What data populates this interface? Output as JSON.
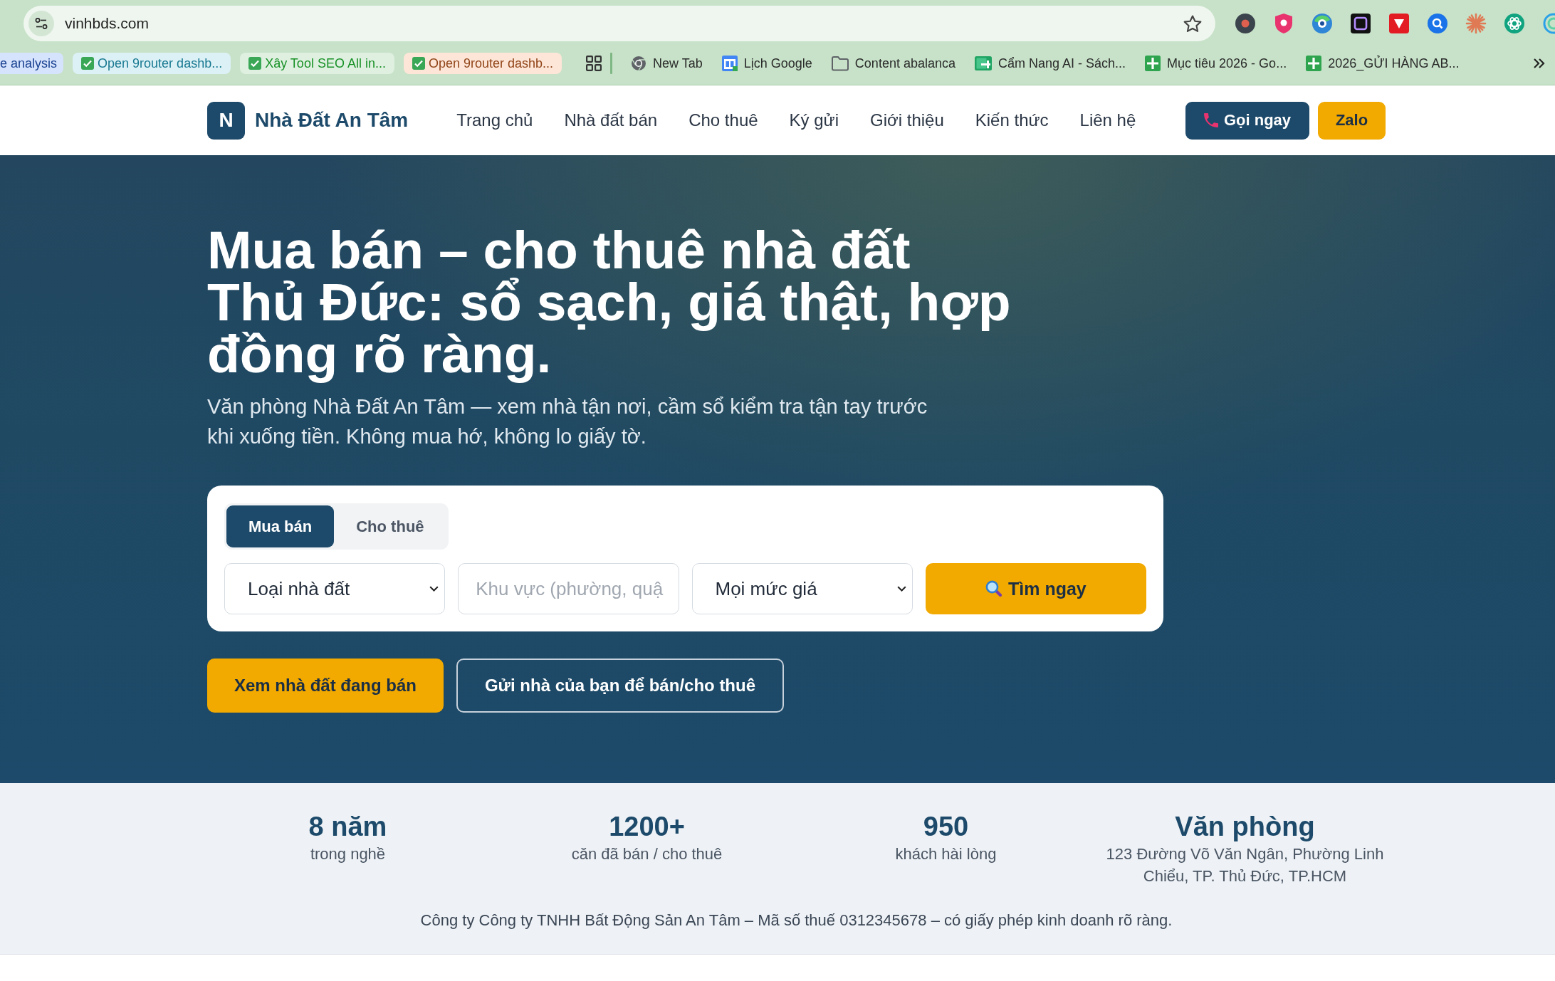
{
  "browser": {
    "address": "vinhbds.com",
    "tab_groups": [
      {
        "label": "e analysis",
        "color": "#d6e3fc",
        "kind": "plain"
      },
      {
        "label": "Open 9router dashb...",
        "color": "#dcf1f6",
        "kind": "checked"
      },
      {
        "label": "Xây Tool SEO All in...",
        "color": "#dff0e1",
        "kind": "checked"
      },
      {
        "label": "Open 9router dashb...",
        "color": "#fde6d8",
        "kind": "checked"
      }
    ],
    "bookmarks": [
      {
        "label": "New Tab",
        "kind": "browser"
      },
      {
        "label": "Lịch Google",
        "kind": "calendar"
      },
      {
        "label": "Content abalanca",
        "kind": "folder"
      },
      {
        "label": "Cẩm Nang AI - Sách...",
        "kind": "slides"
      },
      {
        "label": "Mục tiêu 2026 - Go...",
        "kind": "sheet"
      },
      {
        "label": "2026_GỬI HÀNG AB...",
        "kind": "sheet"
      }
    ]
  },
  "header": {
    "logo": "N",
    "site_name": "Nhà Đất An Tâm",
    "nav": [
      "Trang chủ",
      "Nhà đất bán",
      "Cho thuê",
      "Ký gửi",
      "Giới thiệu",
      "Kiến thức",
      "Liên hệ"
    ],
    "call_button": "Gọi ngay",
    "zalo_button": "Zalo"
  },
  "hero": {
    "title": "Mua bán – cho thuê nhà đất Thủ Đức: sổ sạch, giá thật, hợp đồng rõ ràng.",
    "subtitle": "Văn phòng Nhà Đất An Tâm — xem nhà tận nơi, cầm sổ kiểm tra tận tay trước khi xuống tiền. Không mua hớ, không lo giấy tờ.",
    "search": {
      "tabs": [
        {
          "label": "Mua bán",
          "selected": true
        },
        {
          "label": "Cho thuê",
          "selected": false
        }
      ],
      "fields": [
        {
          "kind": "select",
          "value": "Loại nhà đất"
        },
        {
          "kind": "input",
          "placeholder": "Khu vực (phường, quậ"
        },
        {
          "kind": "select",
          "value": "Mọi mức giá"
        }
      ],
      "button": "Tìm ngay"
    },
    "actions": [
      {
        "label": "Xem nhà đất đang bán",
        "kind": "primary"
      },
      {
        "label": "Gửi nhà của bạn để bán/cho thuê",
        "kind": "outline"
      }
    ]
  },
  "stats": [
    {
      "value": "8 năm",
      "label": "trong nghề"
    },
    {
      "value": "1200+",
      "label": "căn đã bán / cho thuê"
    },
    {
      "value": "950",
      "label": "khách hài lòng"
    },
    {
      "value": "Văn phòng",
      "label": "123 Đường Võ Văn Ngân, Phường Linh Chiểu, TP. Thủ Đức, TP.HCM"
    }
  ],
  "company_info": "Công ty Công ty TNHH Bất Động Sản An Tâm – Mã số thuế 0312345678 – có giấy phép kinh doanh rõ ràng."
}
